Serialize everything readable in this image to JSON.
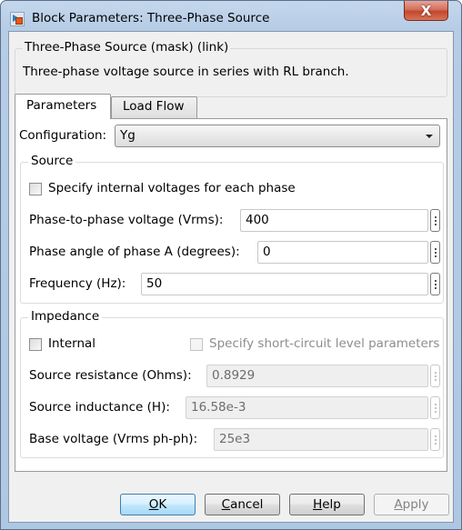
{
  "window": {
    "title": "Block Parameters: Three-Phase Source",
    "close_label": "X"
  },
  "mask": {
    "title": "Three-Phase Source (mask) (link)",
    "description": "Three-phase voltage source in series with RL branch."
  },
  "tabs": [
    {
      "label": "Parameters",
      "active": true
    },
    {
      "label": "Load Flow",
      "active": false
    }
  ],
  "configuration": {
    "label": "Configuration:",
    "value": "Yg"
  },
  "source_group": {
    "title": "Source",
    "specify_internal": {
      "label": "Specify internal voltages for each phase",
      "checked": false
    },
    "fields": [
      {
        "label": "Phase-to-phase voltage (Vrms):",
        "value": "400"
      },
      {
        "label": "Phase angle of phase A (degrees):",
        "value": "0"
      },
      {
        "label": "Frequency (Hz):",
        "value": "50"
      }
    ]
  },
  "impedance_group": {
    "title": "Impedance",
    "internal": {
      "label": "Internal",
      "checked": false
    },
    "short_circuit": {
      "label": "Specify short-circuit level parameters",
      "checked": false,
      "enabled": false
    },
    "fields": [
      {
        "label": "Source resistance (Ohms):",
        "value": "0.8929"
      },
      {
        "label": "Source inductance (H):",
        "value": "16.58e-3"
      },
      {
        "label": "Base voltage (Vrms ph-ph):",
        "value": "25e3"
      }
    ]
  },
  "buttons": {
    "ok": {
      "mnemonic": "O",
      "rest": "K"
    },
    "cancel": {
      "mnemonic": "C",
      "rest": "ancel"
    },
    "help": {
      "mnemonic": "H",
      "rest": "elp"
    },
    "apply": {
      "mnemonic": "A",
      "rest": "pply"
    }
  }
}
